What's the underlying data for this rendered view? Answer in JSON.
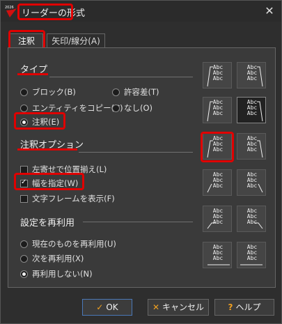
{
  "window": {
    "title": "リーダーの形式",
    "close_glyph": "✕",
    "icon_label": "2026"
  },
  "tabs": [
    {
      "label": "注釈"
    },
    {
      "label": "矢印/線分(A)"
    }
  ],
  "type_section": {
    "title": "タイプ",
    "options": [
      {
        "label": "ブロック(B)",
        "checked": false
      },
      {
        "label": "許容差(T)",
        "checked": false
      },
      {
        "label": "エンティティをコピー(C)",
        "checked": false
      },
      {
        "label": "なし(O)",
        "checked": false
      },
      {
        "label": "注釈(E)",
        "checked": true
      }
    ]
  },
  "annotation_section": {
    "title": "注釈オプション",
    "options": [
      {
        "label": "左寄せで位置揃え(L)",
        "checked": false
      },
      {
        "label": "幅を指定(W)",
        "checked": true
      },
      {
        "label": "文字フレームを表示(F)",
        "checked": false
      }
    ]
  },
  "reuse_section": {
    "title": "設定を再利用",
    "options": [
      {
        "label": "現在のものを再利用(U)",
        "checked": false
      },
      {
        "label": "次を再利用(X)",
        "checked": false
      },
      {
        "label": "再利用しない(N)",
        "checked": true
      }
    ]
  },
  "preview_text": "Abc",
  "buttons": {
    "ok": "OK",
    "cancel": "キャンセル",
    "help": "ヘルプ"
  },
  "colors": {
    "highlight": "#e00000",
    "accent": "#f0a020",
    "background": "#2e2e2e"
  }
}
